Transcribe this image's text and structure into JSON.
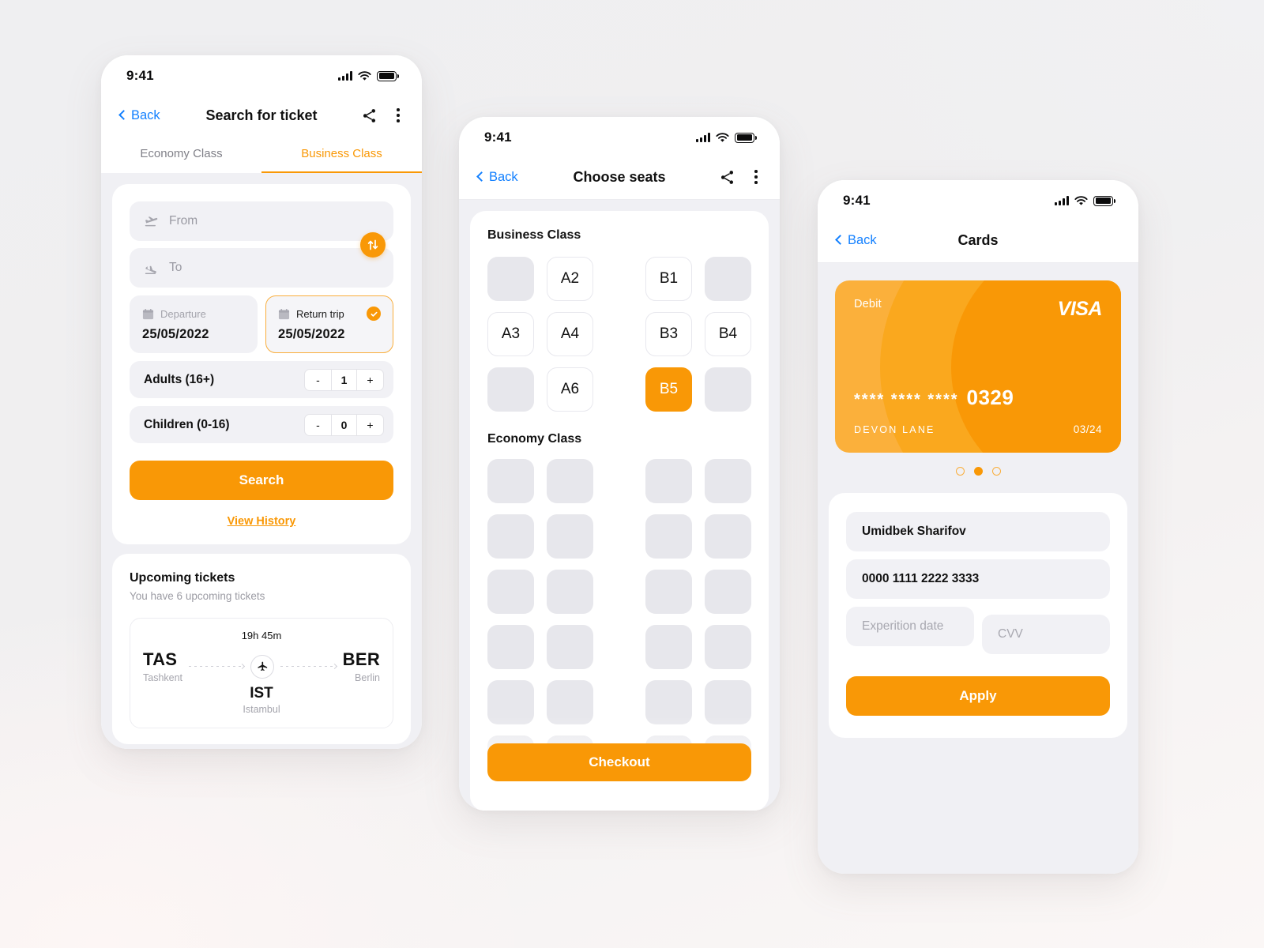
{
  "theme": {
    "accent": "#f99806",
    "accent_light": "#fbb03b",
    "link_blue": "#1380ff",
    "bg": "#f0f0f4"
  },
  "phone1": {
    "status": {
      "time": "9:41"
    },
    "nav": {
      "back": "Back",
      "title": "Search for ticket"
    },
    "tabs": [
      {
        "label": "Economy Class",
        "active": false
      },
      {
        "label": "Business Class",
        "active": true
      }
    ],
    "form": {
      "from_placeholder": "From",
      "to_placeholder": "To",
      "departure": {
        "label": "Departure",
        "value": "25/05/2022",
        "selected": false
      },
      "return": {
        "label": "Return trip",
        "value": "25/05/2022",
        "selected": true
      },
      "adults": {
        "label": "Adults (16+)",
        "value": "1",
        "minus": "-",
        "plus": "+"
      },
      "children": {
        "label": "Children (0-16)",
        "value": "0",
        "minus": "-",
        "plus": "+"
      },
      "search_label": "Search",
      "history_label": "View History"
    },
    "upcoming": {
      "title": "Upcoming tickets",
      "subtitle": "You have 6 upcoming tickets",
      "ticket": {
        "duration": "19h 45m",
        "origin_code": "TAS",
        "origin_city": "Tashkent",
        "dest_code": "BER",
        "dest_city": "Berlin",
        "stop_code": "IST",
        "stop_city": "Istambul"
      }
    }
  },
  "phone2": {
    "status": {
      "time": "9:41"
    },
    "nav": {
      "back": "Back",
      "title": "Choose seats"
    },
    "business": {
      "title": "Business Class",
      "rows": [
        [
          {
            "label": "",
            "state": "blocked"
          },
          {
            "label": "A2",
            "state": "free"
          },
          {
            "aisle": true
          },
          {
            "label": "B1",
            "state": "free"
          },
          {
            "label": "",
            "state": "blocked"
          }
        ],
        [
          {
            "label": "A3",
            "state": "free"
          },
          {
            "label": "A4",
            "state": "free"
          },
          {
            "aisle": true
          },
          {
            "label": "B3",
            "state": "free"
          },
          {
            "label": "B4",
            "state": "free"
          }
        ],
        [
          {
            "label": "",
            "state": "blocked"
          },
          {
            "label": "A6",
            "state": "free"
          },
          {
            "aisle": true
          },
          {
            "label": "B5",
            "state": "selected"
          },
          {
            "label": "",
            "state": "blocked"
          }
        ]
      ]
    },
    "economy": {
      "title": "Economy Class",
      "rows": [
        [
          {
            "label": "",
            "state": "blocked"
          },
          {
            "label": "",
            "state": "blocked"
          },
          {
            "aisle": true
          },
          {
            "label": "",
            "state": "blocked"
          },
          {
            "label": "",
            "state": "blocked"
          }
        ],
        [
          {
            "label": "",
            "state": "blocked"
          },
          {
            "label": "",
            "state": "blocked"
          },
          {
            "aisle": true
          },
          {
            "label": "",
            "state": "blocked"
          },
          {
            "label": "",
            "state": "blocked"
          }
        ],
        [
          {
            "label": "",
            "state": "blocked"
          },
          {
            "label": "",
            "state": "blocked"
          },
          {
            "aisle": true
          },
          {
            "label": "",
            "state": "blocked"
          },
          {
            "label": "",
            "state": "blocked"
          }
        ],
        [
          {
            "label": "",
            "state": "blocked"
          },
          {
            "label": "",
            "state": "blocked"
          },
          {
            "aisle": true
          },
          {
            "label": "",
            "state": "blocked"
          },
          {
            "label": "",
            "state": "blocked"
          }
        ],
        [
          {
            "label": "",
            "state": "blocked"
          },
          {
            "label": "",
            "state": "blocked"
          },
          {
            "aisle": true
          },
          {
            "label": "",
            "state": "blocked"
          },
          {
            "label": "",
            "state": "blocked"
          }
        ],
        [
          {
            "label": "",
            "state": "blocked"
          },
          {
            "label": "",
            "state": "blocked"
          },
          {
            "aisle": true
          },
          {
            "label": "",
            "state": "blocked"
          },
          {
            "label": "",
            "state": "blocked"
          }
        ]
      ]
    },
    "checkout_label": "Checkout"
  },
  "phone3": {
    "status": {
      "time": "9:41"
    },
    "nav": {
      "back": "Back",
      "title": "Cards"
    },
    "card": {
      "type": "Debit",
      "brand": "VISA",
      "mask": "**** **** ****",
      "last4": "0329",
      "holder": "DEVON LANE",
      "expiry": "03/24"
    },
    "pagination": {
      "count": 3,
      "active_index": 1
    },
    "form": {
      "holder_value": "Umidbek Sharifov",
      "number_value": "0000 1111 2222 3333",
      "expiry_placeholder": "Experition date",
      "cvv_placeholder": "CVV",
      "apply_label": "Apply"
    }
  }
}
